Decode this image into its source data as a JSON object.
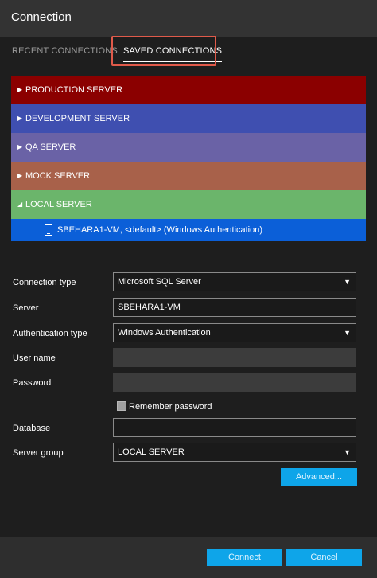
{
  "window": {
    "title": "Connection"
  },
  "tabs": [
    {
      "label": "RECENT CONNECTIONS",
      "active": false
    },
    {
      "label": "SAVED CONNECTIONS",
      "active": true
    }
  ],
  "highlight_color": "#e05a4a",
  "server_groups": [
    {
      "label": "PRODUCTION SERVER",
      "color": "#8b0000",
      "expanded": false
    },
    {
      "label": "DEVELOPMENT SERVER",
      "color": "#3f4fb0",
      "expanded": false
    },
    {
      "label": "QA SERVER",
      "color": "#6a62a6",
      "expanded": false
    },
    {
      "label": "MOCK SERVER",
      "color": "#a8614a",
      "expanded": false
    },
    {
      "label": "LOCAL SERVER",
      "color": "#6bb56b",
      "expanded": true
    }
  ],
  "selected_connection": {
    "label": "SBEHARA1-VM, <default> (Windows Authentication)",
    "color": "#0b5fd8",
    "icon": "database-icon"
  },
  "form": {
    "connection_type": {
      "label": "Connection type",
      "value": "Microsoft SQL Server"
    },
    "server": {
      "label": "Server",
      "value": "SBEHARA1-VM"
    },
    "authentication_type": {
      "label": "Authentication type",
      "value": "Windows Authentication"
    },
    "user_name": {
      "label": "User name",
      "value": ""
    },
    "password": {
      "label": "Password",
      "value": ""
    },
    "remember_password": {
      "label": "Remember password",
      "checked": false
    },
    "database": {
      "label": "Database",
      "value": ""
    },
    "server_group": {
      "label": "Server group",
      "value": "LOCAL SERVER"
    },
    "advanced_label": "Advanced..."
  },
  "footer": {
    "connect_label": "Connect",
    "cancel_label": "Cancel"
  },
  "accent_color": "#0ea5e9"
}
